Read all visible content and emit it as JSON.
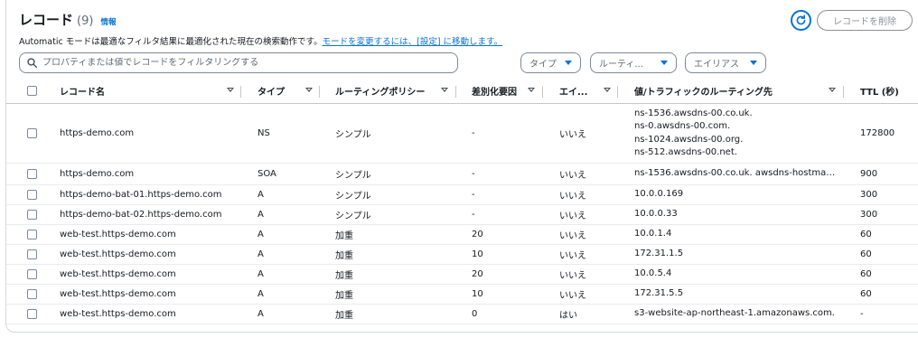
{
  "header": {
    "title": "レコード",
    "count": "(9)",
    "info": "情報",
    "delete_label": "レコードを削除"
  },
  "description": {
    "text": "Automatic モードは最適なフィルタ結果に最適化された現在の検索動作です。",
    "link": "モードを変更するには、[設定] に移動します。"
  },
  "search": {
    "placeholder": "プロパティまたは値でレコードをフィルタリングする"
  },
  "filters": {
    "type": "タイプ",
    "routing": "ルーティ...",
    "alias": "エイリアス"
  },
  "columns": [
    "レコード名",
    "タイプ",
    "ルーティングポリシー",
    "差別化要因",
    "エイ...",
    "値/トラフィックのルーティング先",
    "TTL (秒)"
  ],
  "rows": [
    {
      "name": "https-demo.com",
      "type": "NS",
      "routing": "シンプル",
      "diff": "-",
      "alias": "いいえ",
      "value": [
        "ns-1536.awsdns-00.co.uk.",
        "ns-0.awsdns-00.com.",
        "ns-1024.awsdns-00.org.",
        "ns-512.awsdns-00.net."
      ],
      "ttl": "172800"
    },
    {
      "name": "https-demo.com",
      "type": "SOA",
      "routing": "シンプル",
      "diff": "-",
      "alias": "いいえ",
      "value": [
        "ns-1536.awsdns-00.co.uk. awsdns-hostmast..."
      ],
      "ttl": "900"
    },
    {
      "name": "https-demo-bat-01.https-demo.com",
      "type": "A",
      "routing": "シンプル",
      "diff": "-",
      "alias": "いいえ",
      "value": [
        "10.0.0.169"
      ],
      "ttl": "300"
    },
    {
      "name": "https-demo-bat-02.https-demo.com",
      "type": "A",
      "routing": "シンプル",
      "diff": "-",
      "alias": "いいえ",
      "value": [
        "10.0.0.33"
      ],
      "ttl": "300"
    },
    {
      "name": "web-test.https-demo.com",
      "type": "A",
      "routing": "加重",
      "diff": "20",
      "alias": "いいえ",
      "value": [
        "10.0.1.4"
      ],
      "ttl": "60"
    },
    {
      "name": "web-test.https-demo.com",
      "type": "A",
      "routing": "加重",
      "diff": "10",
      "alias": "いいえ",
      "value": [
        "172.31.1.5"
      ],
      "ttl": "60"
    },
    {
      "name": "web-test.https-demo.com",
      "type": "A",
      "routing": "加重",
      "diff": "20",
      "alias": "いいえ",
      "value": [
        "10.0.5.4"
      ],
      "ttl": "60"
    },
    {
      "name": "web-test.https-demo.com",
      "type": "A",
      "routing": "加重",
      "diff": "10",
      "alias": "いいえ",
      "value": [
        "172.31.5.5"
      ],
      "ttl": "60"
    },
    {
      "name": "web-test.https-demo.com",
      "type": "A",
      "routing": "加重",
      "diff": "0",
      "alias": "はい",
      "value": [
        "s3-website-ap-northeast-1.amazonaws.com."
      ],
      "ttl": "-"
    }
  ],
  "colors": {
    "accent": "#0972d3",
    "text": "#16191f",
    "muted": "#5f6b7a"
  },
  "icons": {
    "refresh": "refresh-icon",
    "search": "search-icon",
    "sort": "sort-icon",
    "caret": "caret-down-icon"
  }
}
